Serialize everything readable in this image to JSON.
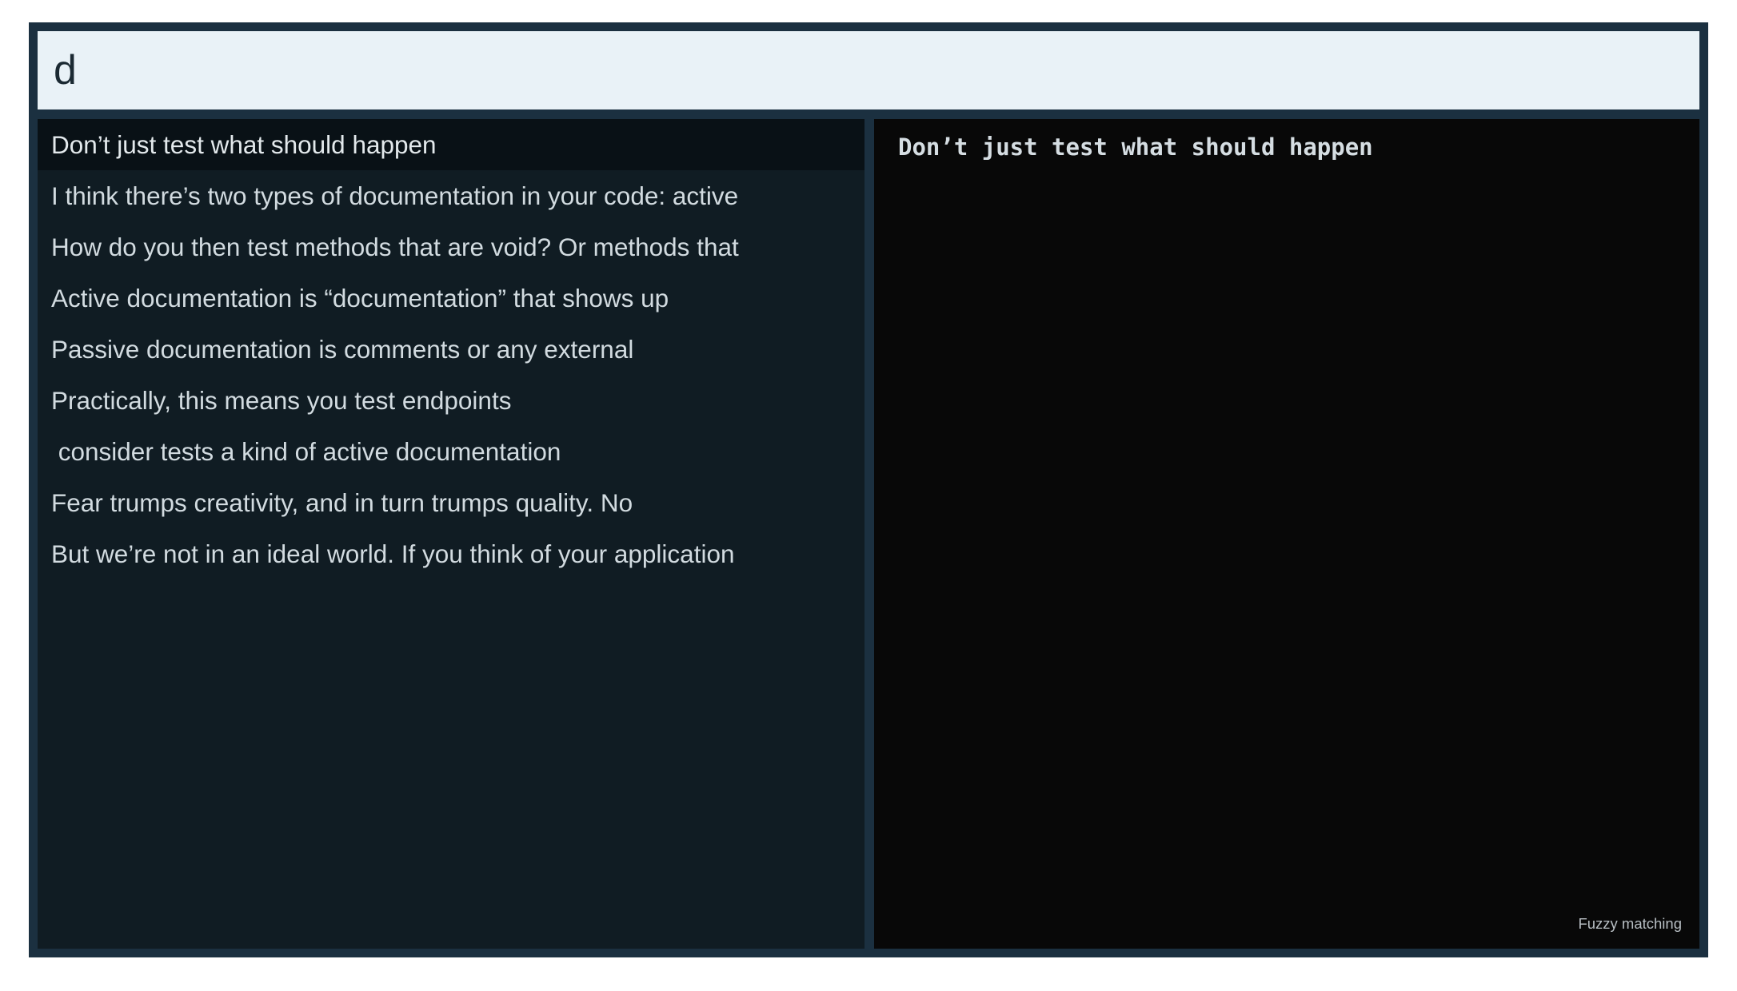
{
  "search": {
    "value": "d",
    "placeholder": ""
  },
  "results": [
    "Don’t just test what should happen",
    "I think there’s two types of documentation in your code: active",
    "How do you then test methods that are void? Or methods that",
    "Active documentation is “documentation” that shows up",
    "Passive documentation is comments or any external",
    "Practically, this means you test endpoints",
    " consider tests a kind of active documentation",
    "Fear trumps creativity, and in turn trumps quality. No",
    "But we’re not in an ideal world. If you think of your application"
  ],
  "selected_index": 0,
  "preview": {
    "text": "Don’t just test what should happen"
  },
  "mode_label": "Fuzzy matching",
  "colors": {
    "frame": "#1b3040",
    "search_background": "#e9f2f7",
    "results_background": "#101c23",
    "selected_row": "#091116",
    "preview_background": "#080808"
  }
}
